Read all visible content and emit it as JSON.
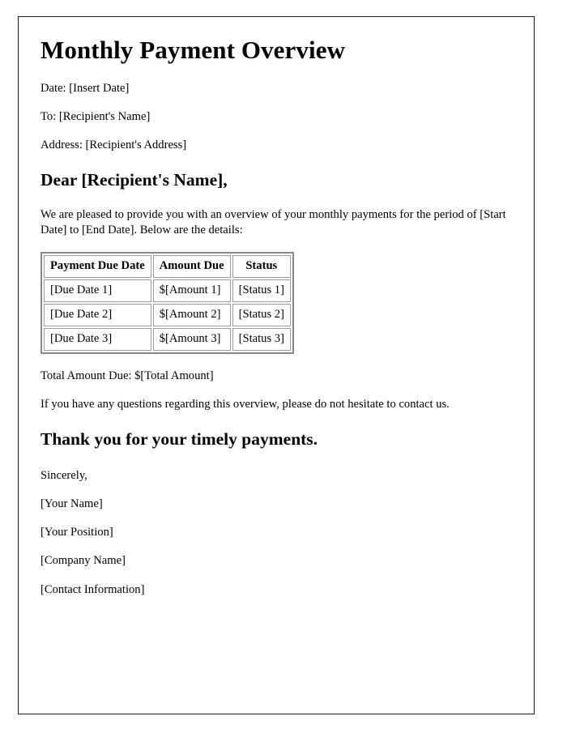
{
  "document": {
    "title": "Monthly Payment Overview",
    "header_fields": [
      "Date: [Insert Date]",
      "To: [Recipient's Name]",
      "Address: [Recipient's Address]"
    ],
    "salutation": "Dear [Recipient's Name],",
    "intro_paragraph": "We are pleased to provide you with an overview of your monthly payments for the period of [Start Date] to [End Date]. Below are the details:",
    "table": {
      "columns": [
        "Payment Due Date",
        "Amount Due",
        "Status"
      ],
      "rows": [
        [
          "[Due Date 1]",
          "$[Amount 1]",
          "[Status 1]"
        ],
        [
          "[Due Date 2]",
          "$[Amount 2]",
          "[Status 2]"
        ],
        [
          "[Due Date 3]",
          "$[Amount 3]",
          "[Status 3]"
        ]
      ]
    },
    "total_line": "Total Amount Due: $[Total Amount]",
    "closing_note": "If you have any questions regarding this overview, please do not hesitate to contact us.",
    "thanks_heading": "Thank you for your timely payments.",
    "signature_block": [
      "Sincerely,",
      "[Your Name]",
      "[Your Position]",
      "[Company Name]",
      "[Contact Information]"
    ]
  }
}
